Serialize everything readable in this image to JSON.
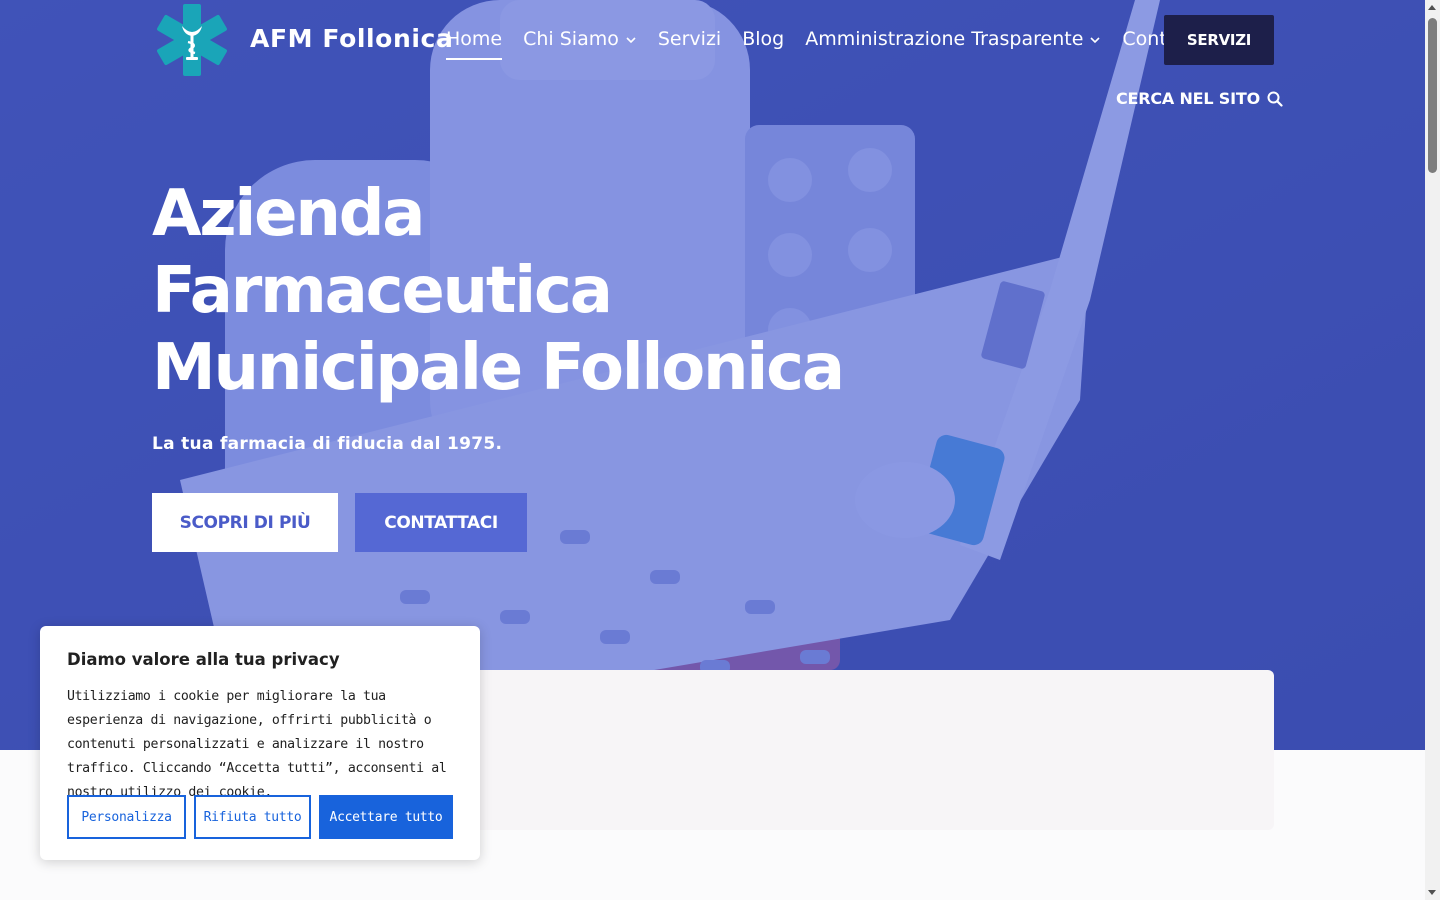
{
  "header": {
    "brand": "AFM Follonica",
    "nav": [
      {
        "label": "Home",
        "active": true,
        "dropdown": false
      },
      {
        "label": "Chi Siamo",
        "active": false,
        "dropdown": true
      },
      {
        "label": "Servizi",
        "active": false,
        "dropdown": false
      },
      {
        "label": "Blog",
        "active": false,
        "dropdown": false
      },
      {
        "label": "Amministrazione Trasparente",
        "active": false,
        "dropdown": true
      },
      {
        "label": "Contatti",
        "active": false,
        "dropdown": false
      }
    ],
    "cta": "SERVIZI",
    "search": "CERCA NEL SITO",
    "search_icon": "search-icon",
    "logo_icon": "pharmacy-caduceus-logo"
  },
  "hero": {
    "title_lines": [
      "Azienda",
      "Farmaceutica",
      "Municipale Follonica"
    ],
    "subtitle": "La tua farmacia di fiducia dal 1975.",
    "btn_primary": "SCOPRI DI PIÙ",
    "btn_secondary": "CONTATTACI"
  },
  "cookie": {
    "title": "Diamo valore alla tua privacy",
    "text": "Utilizziamo i cookie per migliorare la tua esperienza di navigazione, offrirti pubblicità o contenuti personalizzati e analizzare il nostro traffico. Cliccando “Accetta tutti”, acconsenti al nostro utilizzo dei cookie.",
    "btn_customize": "Personalizza",
    "btn_reject": "Rifiuta tutto",
    "btn_accept": "Accettare tutto"
  },
  "colors": {
    "hero_overlay": "#4e62d4",
    "header_cta_bg": "#1d1f4a",
    "cookie_accent": "#1863dc",
    "logo_teal": "#1aa5b8"
  }
}
